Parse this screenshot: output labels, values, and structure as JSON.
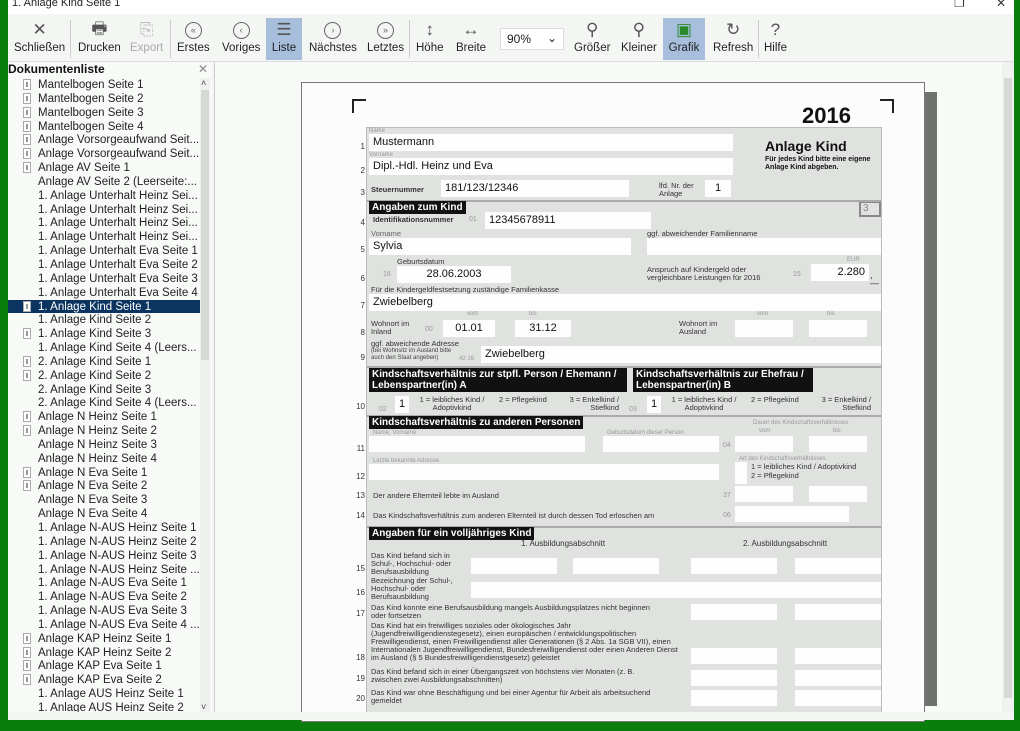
{
  "window": {
    "title": "1. Anlage Kind Seite 1",
    "restore_glyph": "❐",
    "close_glyph": "✕"
  },
  "toolbar": {
    "buttons": [
      {
        "label": "Schließen",
        "icon": "close-icon",
        "glyph": "✕"
      },
      {
        "label": "Drucken",
        "icon": "printer-icon",
        "glyph": "🖶"
      },
      {
        "label": "Export",
        "icon": "export-icon",
        "glyph": "⎘"
      },
      {
        "label": "Erstes",
        "icon": "first-icon",
        "glyph": "«"
      },
      {
        "label": "Voriges",
        "icon": "previous-icon",
        "glyph": "‹"
      },
      {
        "label": "Liste",
        "icon": "list-icon",
        "glyph": "☰"
      },
      {
        "label": "Nächstes",
        "icon": "next-icon",
        "glyph": "›"
      },
      {
        "label": "Letztes",
        "icon": "last-icon",
        "glyph": "»"
      },
      {
        "label": "Höhe",
        "icon": "fit-height-icon",
        "glyph": "↕"
      },
      {
        "label": "Breite",
        "icon": "fit-width-icon",
        "glyph": "↔"
      },
      {
        "label": "Größer",
        "icon": "zoom-in-icon",
        "glyph": "⚲"
      },
      {
        "label": "Kleiner",
        "icon": "zoom-out-icon",
        "glyph": "⚲"
      },
      {
        "label": "Grafik",
        "icon": "graphic-icon",
        "glyph": "▣"
      },
      {
        "label": "Refresh",
        "icon": "refresh-icon",
        "glyph": "↻"
      },
      {
        "label": "Hilfe",
        "icon": "help-icon",
        "glyph": "?"
      }
    ],
    "zoom_value": "90%",
    "zoom_chevron": "⌄"
  },
  "sidebar": {
    "title": "Dokumentenliste",
    "close_glyph": "✕",
    "scroll_up": "˄",
    "scroll_down": "˅",
    "items": [
      {
        "label": "Mantelbogen Seite 1",
        "icon": true
      },
      {
        "label": "Mantelbogen Seite 2",
        "icon": true
      },
      {
        "label": "Mantelbogen Seite 3",
        "icon": true
      },
      {
        "label": "Mantelbogen Seite 4",
        "icon": true
      },
      {
        "label": "Anlage Vorsorgeaufwand Seit...",
        "icon": true
      },
      {
        "label": "Anlage Vorsorgeaufwand Seit...",
        "icon": true
      },
      {
        "label": "Anlage AV Seite 1",
        "icon": true
      },
      {
        "label": "Anlage AV Seite 2 (Leerseite:...",
        "icon": false
      },
      {
        "label": "1. Anlage Unterhalt Heinz Sei...",
        "icon": false
      },
      {
        "label": "1. Anlage Unterhalt Heinz Sei...",
        "icon": false
      },
      {
        "label": "1. Anlage Unterhalt Heinz Sei...",
        "icon": false
      },
      {
        "label": "1. Anlage Unterhalt Heinz Sei...",
        "icon": false
      },
      {
        "label": "1. Anlage Unterhalt Eva Seite 1",
        "icon": false
      },
      {
        "label": "1. Anlage Unterhalt Eva Seite 2",
        "icon": false
      },
      {
        "label": "1. Anlage Unterhalt Eva Seite 3",
        "icon": false
      },
      {
        "label": "1. Anlage Unterhalt Eva Seite 4",
        "icon": false
      },
      {
        "label": "1. Anlage Kind Seite 1",
        "icon": true,
        "selected": true
      },
      {
        "label": "1. Anlage Kind Seite 2",
        "icon": false
      },
      {
        "label": "1. Anlage Kind Seite 3",
        "icon": true
      },
      {
        "label": "1. Anlage Kind Seite 4 (Leers...",
        "icon": false
      },
      {
        "label": "2. Anlage Kind Seite 1",
        "icon": true
      },
      {
        "label": "2. Anlage Kind Seite 2",
        "icon": true
      },
      {
        "label": "2. Anlage Kind Seite 3",
        "icon": false
      },
      {
        "label": "2. Anlage Kind Seite 4 (Leers...",
        "icon": false
      },
      {
        "label": "Anlage N Heinz Seite 1",
        "icon": true
      },
      {
        "label": "Anlage N Heinz Seite 2",
        "icon": true
      },
      {
        "label": "Anlage N Heinz Seite 3",
        "icon": false
      },
      {
        "label": "Anlage N Heinz Seite 4",
        "icon": false
      },
      {
        "label": "Anlage N Eva Seite 1",
        "icon": true
      },
      {
        "label": "Anlage N Eva Seite 2",
        "icon": true
      },
      {
        "label": "Anlage N Eva Seite 3",
        "icon": false
      },
      {
        "label": "Anlage N Eva Seite 4",
        "icon": false
      },
      {
        "label": "1. Anlage N-AUS Heinz Seite 1",
        "icon": false
      },
      {
        "label": "1. Anlage N-AUS Heinz Seite 2",
        "icon": false
      },
      {
        "label": "1. Anlage N-AUS Heinz Seite 3",
        "icon": false
      },
      {
        "label": "1. Anlage N-AUS Heinz Seite ...",
        "icon": false
      },
      {
        "label": "1. Anlage N-AUS Eva Seite 1",
        "icon": false
      },
      {
        "label": "1. Anlage N-AUS Eva Seite 2",
        "icon": false
      },
      {
        "label": "1. Anlage N-AUS Eva Seite 3",
        "icon": false
      },
      {
        "label": "1. Anlage N-AUS Eva Seite 4 ...",
        "icon": false
      },
      {
        "label": "Anlage KAP Heinz Seite 1",
        "icon": true
      },
      {
        "label": "Anlage KAP Heinz Seite 2",
        "icon": true
      },
      {
        "label": "Anlage KAP Eva Seite 1",
        "icon": true
      },
      {
        "label": "Anlage KAP Eva Seite 2",
        "icon": true
      },
      {
        "label": "1. Anlage AUS Heinz Seite 1",
        "icon": false
      },
      {
        "label": "1. Anlage AUS Heinz Seite 2",
        "icon": false
      }
    ]
  },
  "document": {
    "year": "2016",
    "title": "Anlage Kind",
    "subtitle": "Für jedes Kind bitte eine eigene Anlage Kind abgeben.",
    "box_number": "3",
    "line_numbers": [
      "1",
      "2",
      "3",
      "4",
      "5",
      "6",
      "7",
      "8",
      "9",
      "10",
      "11",
      "12",
      "13",
      "14",
      "15",
      "16",
      "17",
      "18",
      "19",
      "20"
    ],
    "name_label": "Name",
    "name": "Mustermann",
    "vorname_label": "Vorname",
    "vorname": "Dipl.-Hdl. Heinz und Eva",
    "steuernummer_label": "Steuernummer",
    "steuernummer": "181/123/12346",
    "lfd_nr_label": "lfd. Nr. der Anlage",
    "lfd_nr": "1",
    "section_kind": "Angaben zum Kind",
    "id_label": "Identifikationsnummer",
    "id_code": "01",
    "id_value": "12345678911",
    "kind_vorname_label": "Vorname",
    "kind_vorname": "Sylvia",
    "familienname_label": "ggf. abweichender Familienname",
    "geburtsdatum_label": "Geburtsdatum",
    "geburtsdatum_code": "16",
    "geburtsdatum": "28.06.2003",
    "kindergeld_label": "Anspruch auf Kindergeld oder vergleichbare Leistungen für 2016",
    "kindergeld_code": "15",
    "eur_label": "EUR",
    "kindergeld_value": "2.280",
    "kindergeld_suffix": ",—",
    "familienkasse_label": "Für die Kindergeldfestsetzung zuständige Familienkasse",
    "familienkasse": "Zwiebelberg",
    "wohnort_inland_label": "Wohnort im Inland",
    "wohnort_inland_code": "00",
    "vom_label": "vom",
    "bis_label": "bis",
    "inland_vom": "01.01",
    "inland_bis": "31.12",
    "wohnort_ausland_label": "Wohnort im Ausland",
    "adresse_label": "ggf. abweichende Adresse",
    "adresse_sublabel": "(bei Wohnsitz im Ausland bitte auch den Staat angeben)",
    "adresse_code": "42 16",
    "adresse": "Zwiebelberg",
    "section_a": "Kindschaftsverhältnis zur stpfl. Person / Ehemann / Lebenspartner(in) A",
    "section_b": "Kindschaftsverhältnis zur Ehefrau / Lebenspartner(in) B",
    "a_code": "02",
    "a_value": "1",
    "b_code": "03",
    "b_value": "1",
    "opt1": "1 = leibliches Kind / Adoptivkind",
    "opt2": "2 = Pflegekind",
    "opt3": "3 = Enkelkind / Stiefkind",
    "section_andere": "Kindschaftsverhältnis zu anderen Personen",
    "name_vorname_label": "Name, Vorname",
    "geburtsdatum_person_label": "Geburtsdatum dieser Person",
    "dauer_label": "Dauer des Kindschaftsverhältnisses",
    "dauer_code": "04",
    "adresse_letzte_label": "Letzte bekannte Adresse",
    "art_label": "Art des Kindschaftsverhältnisses",
    "art_opt1": "1 = leibliches Kind / Adoptivkind",
    "art_opt2": "2 = Pflegekind",
    "line13": "Der andere Elternteil lebte im Ausland",
    "line13_code": "37",
    "line14": "Das Kindschaftsverhältnis zum anderen Elternteil ist durch dessen Tod erloschen am",
    "line14_code": "06",
    "section_volljaehrig": "Angaben für ein volljähriges Kind",
    "abschnitt1": "1. Ausbildungsabschnitt",
    "abschnitt2": "2. Ausbildungsabschnitt",
    "line15": "Das Kind befand sich in Schul-, Hochschul- oder Berufsausbildung",
    "line16": "Bezeichnung der Schul-, Hochschul- oder Berufsausbildung",
    "line17": "Das Kind konnte eine Berufsausbildung mangels Ausbildungsplatzes nicht beginnen oder fortsetzen",
    "line18": "Das Kind hat ein freiwilliges soziales oder ökologisches Jahr (Jugendfreiwilligendienstegesetz), einen europäischen / entwicklungspolitischen Freiwilligendienst, einen Freiwilligendienst aller Generationen (§ 2 Abs. 1a SGB VII), einen Internationalen Jugendfreiwilligendienst, Bundesfreiwilligendienst oder einen Anderen Dienst im Ausland (§ 5 Bundesfreiwilligendienstgesetz) geleistet",
    "line19": "Das Kind befand sich in einer Übergangszeit von höchstens vier Monaten (z. B. zwischen zwei Ausbildungsabschnitten)",
    "line20": "Das Kind war ohne Beschäftigung und bei einer Agentur für Arbeit als arbeitsuchend gemeldet"
  },
  "colors": {
    "accent_frame": "#0a7d0a",
    "selection": "#0c3461",
    "active_button": "#a7bedc"
  }
}
